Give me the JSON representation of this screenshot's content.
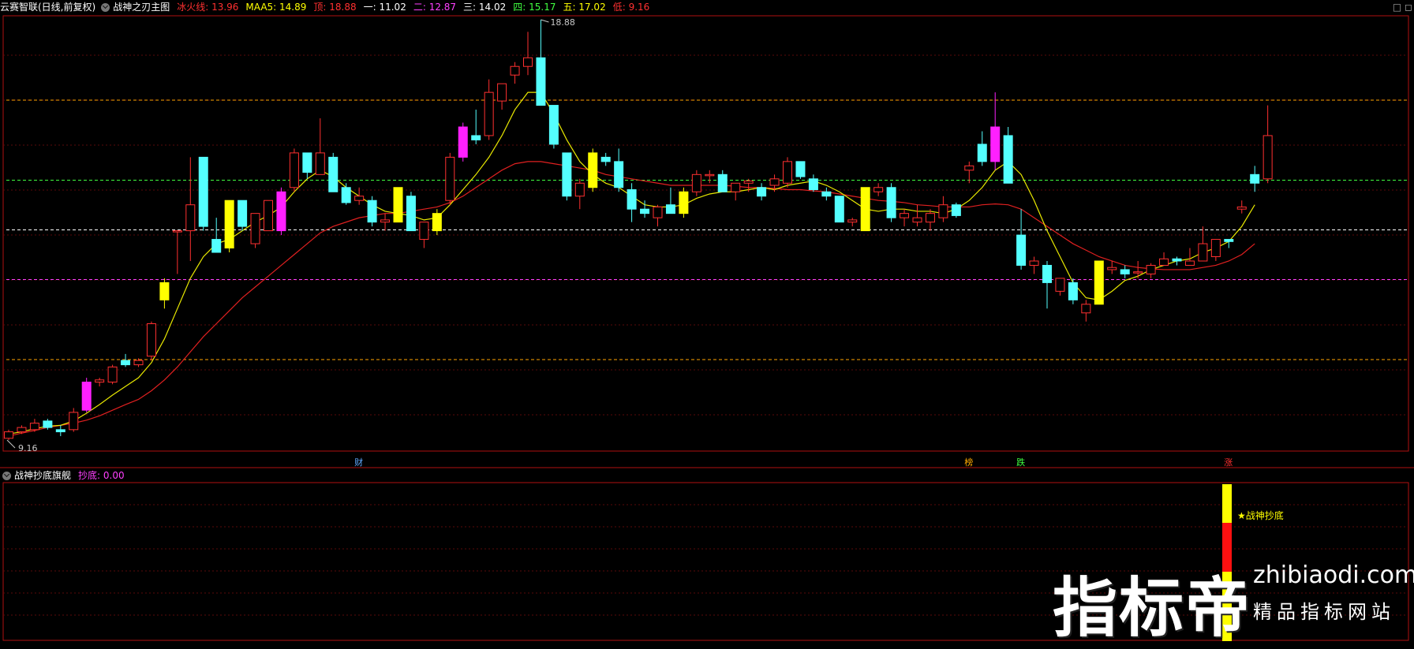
{
  "header": {
    "title": "云赛智联(日线,前复权)",
    "indicator": "战神之刃主图",
    "items": [
      {
        "label": "冰火线: ",
        "value": "13.96",
        "color": "#ff3030"
      },
      {
        "label": "MAA5: ",
        "value": "14.89",
        "color": "#ffff00"
      },
      {
        "label": "顶: ",
        "value": "18.88",
        "color": "#ff3030"
      },
      {
        "label": "一: ",
        "value": "11.02",
        "color": "#ffffff"
      },
      {
        "label": "二: ",
        "value": "12.87",
        "color": "#ff40ff"
      },
      {
        "label": "三: ",
        "value": "14.02",
        "color": "#ffffff"
      },
      {
        "label": "四: ",
        "value": "15.17",
        "color": "#40ff40"
      },
      {
        "label": "五: ",
        "value": "17.02",
        "color": "#ffff00"
      },
      {
        "label": "低: ",
        "value": "9.16",
        "color": "#ff3030"
      }
    ]
  },
  "sub_header": {
    "title": "战神抄底旗舰",
    "items": [
      {
        "label": "抄底: ",
        "value": "0.00",
        "color": "#ff40ff"
      }
    ]
  },
  "window_controls": "□ ◻",
  "markers": [
    {
      "text": "财",
      "candle": 27,
      "color": "#5fa8ff"
    },
    {
      "text": "榜",
      "candle": 74,
      "color": "#ffaa00"
    },
    {
      "text": "跌",
      "candle": 78,
      "color": "#40ff40"
    },
    {
      "text": "涨",
      "candle": 94,
      "color": "#ff3030"
    }
  ],
  "annotation": {
    "text": "★战神抄底",
    "color": "#ffff00"
  },
  "watermark": {
    "big": "指标帝",
    "url": "zhibiaodi.com",
    "sub": "精品指标网站"
  },
  "chart_data": {
    "type": "candlestick",
    "ylim": [
      9.16,
      18.88
    ],
    "high_label": "18.88",
    "low_label": "9.16",
    "levels": [
      {
        "name": "一",
        "value": 11.02,
        "color": "#ffa500"
      },
      {
        "name": "二",
        "value": 12.87,
        "color": "#ff40ff"
      },
      {
        "name": "三",
        "value": 14.02,
        "color": "#ffffff"
      },
      {
        "name": "四",
        "value": 15.17,
        "color": "#40ff40"
      },
      {
        "name": "五",
        "value": 17.02,
        "color": "#ffa500"
      }
    ],
    "colors": {
      "up": "#ff3030",
      "down": "#54ffff",
      "yellow": "#ffff00",
      "magenta": "#ff20ff"
    },
    "candles": [
      {
        "o": 9.2,
        "h": 9.4,
        "l": 9.16,
        "c": 9.35
      },
      {
        "o": 9.35,
        "h": 9.5,
        "l": 9.3,
        "c": 9.45
      },
      {
        "o": 9.4,
        "h": 9.65,
        "l": 9.35,
        "c": 9.55
      },
      {
        "o": 9.6,
        "h": 9.65,
        "l": 9.4,
        "c": 9.45
      },
      {
        "o": 9.4,
        "h": 9.5,
        "l": 9.25,
        "c": 9.35
      },
      {
        "o": 9.4,
        "h": 9.9,
        "l": 9.35,
        "c": 9.8
      },
      {
        "o": 9.85,
        "h": 10.6,
        "l": 9.8,
        "c": 10.5,
        "k": "magenta"
      },
      {
        "o": 10.5,
        "h": 10.6,
        "l": 10.4,
        "c": 10.55
      },
      {
        "o": 10.5,
        "h": 10.9,
        "l": 10.45,
        "c": 10.85
      },
      {
        "o": 11.0,
        "h": 11.15,
        "l": 10.85,
        "c": 10.9
      },
      {
        "o": 10.9,
        "h": 11.05,
        "l": 10.85,
        "c": 11.0
      },
      {
        "o": 11.1,
        "h": 11.9,
        "l": 11.0,
        "c": 11.85
      },
      {
        "o": 12.4,
        "h": 12.9,
        "l": 12.2,
        "c": 12.8,
        "k": "yellow"
      },
      {
        "o": 14.0,
        "h": 14.0,
        "l": 13.0,
        "c": 14.0
      },
      {
        "o": 14.0,
        "h": 15.7,
        "l": 13.3,
        "c": 14.6
      },
      {
        "o": 15.7,
        "h": 15.7,
        "l": 14.0,
        "c": 14.1
      },
      {
        "o": 13.8,
        "h": 14.3,
        "l": 13.6,
        "c": 13.5
      },
      {
        "o": 13.6,
        "h": 14.7,
        "l": 13.5,
        "c": 14.7,
        "k": "yellow"
      },
      {
        "o": 14.7,
        "h": 14.7,
        "l": 14.0,
        "c": 14.1
      },
      {
        "o": 13.7,
        "h": 14.4,
        "l": 13.6,
        "c": 14.4
      },
      {
        "o": 14.0,
        "h": 14.7,
        "l": 14.0,
        "c": 14.7
      },
      {
        "o": 14.0,
        "h": 15.0,
        "l": 13.9,
        "c": 14.9,
        "k": "magenta"
      },
      {
        "o": 15.0,
        "h": 15.9,
        "l": 14.9,
        "c": 15.8
      },
      {
        "o": 15.8,
        "h": 15.8,
        "l": 15.2,
        "c": 15.35
      },
      {
        "o": 15.3,
        "h": 16.6,
        "l": 15.3,
        "c": 15.8
      },
      {
        "o": 15.7,
        "h": 15.8,
        "l": 14.9,
        "c": 14.9
      },
      {
        "o": 15.0,
        "h": 15.1,
        "l": 14.6,
        "c": 14.65
      },
      {
        "o": 14.7,
        "h": 15.0,
        "l": 14.6,
        "c": 14.8
      },
      {
        "o": 14.7,
        "h": 14.8,
        "l": 14.1,
        "c": 14.2
      },
      {
        "o": 14.2,
        "h": 14.4,
        "l": 14.0,
        "c": 14.25
      },
      {
        "o": 14.2,
        "h": 15.0,
        "l": 14.2,
        "c": 15.0,
        "k": "yellow"
      },
      {
        "o": 14.8,
        "h": 14.9,
        "l": 14.0,
        "c": 14.0
      },
      {
        "o": 13.8,
        "h": 14.2,
        "l": 13.6,
        "c": 14.2
      },
      {
        "o": 14.0,
        "h": 14.5,
        "l": 13.9,
        "c": 14.4,
        "k": "yellow"
      },
      {
        "o": 14.7,
        "h": 15.8,
        "l": 14.6,
        "c": 15.7
      },
      {
        "o": 15.7,
        "h": 16.5,
        "l": 15.6,
        "c": 16.4,
        "k": "magenta"
      },
      {
        "o": 16.2,
        "h": 16.8,
        "l": 16.0,
        "c": 16.1
      },
      {
        "o": 16.2,
        "h": 17.5,
        "l": 16.1,
        "c": 17.2
      },
      {
        "o": 17.0,
        "h": 17.4,
        "l": 16.8,
        "c": 17.4
      },
      {
        "o": 17.6,
        "h": 17.9,
        "l": 17.4,
        "c": 17.8
      },
      {
        "o": 17.8,
        "h": 18.6,
        "l": 17.6,
        "c": 18.0
      },
      {
        "o": 18.0,
        "h": 18.88,
        "l": 16.9,
        "c": 16.9
      },
      {
        "o": 16.9,
        "h": 16.9,
        "l": 15.9,
        "c": 16.0
      },
      {
        "o": 15.8,
        "h": 15.8,
        "l": 14.7,
        "c": 14.8
      },
      {
        "o": 14.8,
        "h": 15.2,
        "l": 14.5,
        "c": 15.1
      },
      {
        "o": 15.0,
        "h": 15.9,
        "l": 14.9,
        "c": 15.8,
        "k": "yellow"
      },
      {
        "o": 15.7,
        "h": 15.8,
        "l": 15.5,
        "c": 15.6
      },
      {
        "o": 15.6,
        "h": 15.9,
        "l": 14.9,
        "c": 15.0
      },
      {
        "o": 14.95,
        "h": 15.1,
        "l": 14.2,
        "c": 14.5
      },
      {
        "o": 14.5,
        "h": 14.7,
        "l": 14.3,
        "c": 14.4
      },
      {
        "o": 14.3,
        "h": 14.6,
        "l": 14.1,
        "c": 14.55
      },
      {
        "o": 14.6,
        "h": 15.0,
        "l": 14.4,
        "c": 14.4
      },
      {
        "o": 14.4,
        "h": 15.0,
        "l": 14.3,
        "c": 14.9,
        "k": "yellow"
      },
      {
        "o": 14.9,
        "h": 15.4,
        "l": 14.8,
        "c": 15.3
      },
      {
        "o": 15.3,
        "h": 15.4,
        "l": 15.1,
        "c": 15.3
      },
      {
        "o": 15.3,
        "h": 15.4,
        "l": 14.9,
        "c": 14.9
      },
      {
        "o": 14.9,
        "h": 15.1,
        "l": 14.7,
        "c": 15.1
      },
      {
        "o": 15.1,
        "h": 15.2,
        "l": 14.9,
        "c": 15.15
      },
      {
        "o": 15.0,
        "h": 15.1,
        "l": 14.7,
        "c": 14.8
      },
      {
        "o": 15.05,
        "h": 15.3,
        "l": 14.9,
        "c": 15.2
      },
      {
        "o": 15.1,
        "h": 15.7,
        "l": 15.0,
        "c": 15.6
      },
      {
        "o": 15.6,
        "h": 15.6,
        "l": 15.2,
        "c": 15.25
      },
      {
        "o": 15.2,
        "h": 15.3,
        "l": 14.9,
        "c": 14.95
      },
      {
        "o": 14.9,
        "h": 15.0,
        "l": 14.7,
        "c": 14.8
      },
      {
        "o": 14.8,
        "h": 14.8,
        "l": 14.2,
        "c": 14.2
      },
      {
        "o": 14.2,
        "h": 14.3,
        "l": 14.1,
        "c": 14.25
      },
      {
        "o": 14.0,
        "h": 15.0,
        "l": 14.0,
        "c": 15.0,
        "k": "yellow"
      },
      {
        "o": 14.9,
        "h": 15.1,
        "l": 14.8,
        "c": 15.0
      },
      {
        "o": 15.0,
        "h": 15.1,
        "l": 14.2,
        "c": 14.3
      },
      {
        "o": 14.3,
        "h": 14.5,
        "l": 14.1,
        "c": 14.4
      },
      {
        "o": 14.2,
        "h": 14.6,
        "l": 14.1,
        "c": 14.3
      },
      {
        "o": 14.2,
        "h": 14.5,
        "l": 14.0,
        "c": 14.4
      },
      {
        "o": 14.3,
        "h": 14.8,
        "l": 14.2,
        "c": 14.6
      },
      {
        "o": 14.6,
        "h": 14.65,
        "l": 14.3,
        "c": 14.35
      },
      {
        "o": 15.4,
        "h": 15.6,
        "l": 15.1,
        "c": 15.5
      },
      {
        "o": 16.0,
        "h": 16.3,
        "l": 15.5,
        "c": 15.6
      },
      {
        "o": 15.6,
        "h": 17.2,
        "l": 15.4,
        "c": 16.4,
        "k": "magenta"
      },
      {
        "o": 16.2,
        "h": 16.4,
        "l": 15.1,
        "c": 15.1
      },
      {
        "o": 13.9,
        "h": 14.5,
        "l": 13.1,
        "c": 13.2
      },
      {
        "o": 13.2,
        "h": 13.4,
        "l": 13.0,
        "c": 13.3
      },
      {
        "o": 13.2,
        "h": 13.3,
        "l": 12.2,
        "c": 12.8
      },
      {
        "o": 12.6,
        "h": 12.9,
        "l": 12.5,
        "c": 12.9
      },
      {
        "o": 12.8,
        "h": 12.9,
        "l": 12.3,
        "c": 12.4
      },
      {
        "o": 12.1,
        "h": 12.4,
        "l": 11.9,
        "c": 12.3
      },
      {
        "o": 12.3,
        "h": 13.3,
        "l": 12.3,
        "c": 13.3,
        "k": "yellow"
      },
      {
        "o": 13.1,
        "h": 13.3,
        "l": 13.0,
        "c": 13.15
      },
      {
        "o": 13.1,
        "h": 13.2,
        "l": 12.9,
        "c": 13.0
      },
      {
        "o": 13.05,
        "h": 13.3,
        "l": 12.9,
        "c": 13.05
      },
      {
        "o": 13.0,
        "h": 13.25,
        "l": 12.9,
        "c": 13.2
      },
      {
        "o": 13.2,
        "h": 13.5,
        "l": 13.2,
        "c": 13.35
      },
      {
        "o": 13.35,
        "h": 13.4,
        "l": 13.2,
        "c": 13.3
      },
      {
        "o": 13.2,
        "h": 13.6,
        "l": 13.2,
        "c": 13.3
      },
      {
        "o": 13.3,
        "h": 14.1,
        "l": 13.3,
        "c": 13.7
      },
      {
        "o": 13.4,
        "h": 13.6,
        "l": 13.3,
        "c": 13.8
      },
      {
        "o": 13.8,
        "h": 13.8,
        "l": 13.6,
        "c": 13.75
      },
      {
        "o": 14.5,
        "h": 14.7,
        "l": 14.4,
        "c": 14.55
      },
      {
        "o": 15.3,
        "h": 15.5,
        "l": 14.9,
        "c": 15.1
      },
      {
        "o": 15.2,
        "h": 16.9,
        "l": 15.1,
        "c": 16.2
      }
    ],
    "ma_yellow": [
      9.3,
      9.35,
      9.42,
      9.48,
      9.5,
      9.6,
      9.78,
      9.98,
      10.2,
      10.4,
      10.6,
      10.95,
      11.5,
      12.2,
      12.9,
      13.4,
      13.7,
      13.8,
      14.0,
      14.2,
      14.35,
      14.55,
      14.9,
      15.2,
      15.4,
      15.25,
      15.0,
      14.8,
      14.6,
      14.45,
      14.4,
      14.35,
      14.25,
      14.3,
      14.6,
      14.95,
      15.3,
      15.7,
      16.2,
      16.8,
      17.2,
      17.2,
      16.7,
      16.1,
      15.6,
      15.3,
      15.1,
      15.0,
      14.8,
      14.6,
      14.55,
      14.55,
      14.6,
      14.75,
      14.85,
      14.9,
      14.9,
      14.95,
      15.0,
      14.95,
      15.05,
      15.1,
      15.15,
      15.05,
      14.9,
      14.7,
      14.5,
      14.45,
      14.5,
      14.5,
      14.45,
      14.45,
      14.4,
      14.5,
      14.7,
      15.0,
      15.4,
      15.6,
      15.3,
      14.7,
      14.0,
      13.4,
      12.8,
      12.45,
      12.4,
      12.6,
      12.85,
      12.95,
      13.1,
      13.2,
      13.3,
      13.35,
      13.5,
      13.6,
      13.75,
      14.1,
      14.6
    ],
    "ma_red": [
      9.25,
      9.32,
      9.38,
      9.45,
      9.5,
      9.55,
      9.62,
      9.72,
      9.85,
      9.98,
      10.1,
      10.3,
      10.55,
      10.85,
      11.2,
      11.55,
      11.85,
      12.15,
      12.45,
      12.7,
      12.95,
      13.2,
      13.45,
      13.7,
      13.95,
      14.1,
      14.2,
      14.3,
      14.35,
      14.4,
      14.4,
      14.45,
      14.5,
      14.55,
      14.65,
      14.8,
      15.0,
      15.2,
      15.4,
      15.55,
      15.6,
      15.6,
      15.55,
      15.5,
      15.45,
      15.4,
      15.3,
      15.25,
      15.2,
      15.15,
      15.1,
      15.05,
      15.05,
      15.05,
      15.05,
      15.05,
      15.03,
      15.0,
      15.0,
      14.98,
      14.95,
      14.95,
      14.92,
      14.9,
      14.85,
      14.8,
      14.75,
      14.7,
      14.68,
      14.65,
      14.6,
      14.58,
      14.55,
      14.55,
      14.55,
      14.6,
      14.62,
      14.6,
      14.5,
      14.3,
      14.1,
      13.9,
      13.7,
      13.55,
      13.4,
      13.3,
      13.2,
      13.15,
      13.12,
      13.1,
      13.1,
      13.1,
      13.15,
      13.2,
      13.3,
      13.45,
      13.7
    ]
  }
}
